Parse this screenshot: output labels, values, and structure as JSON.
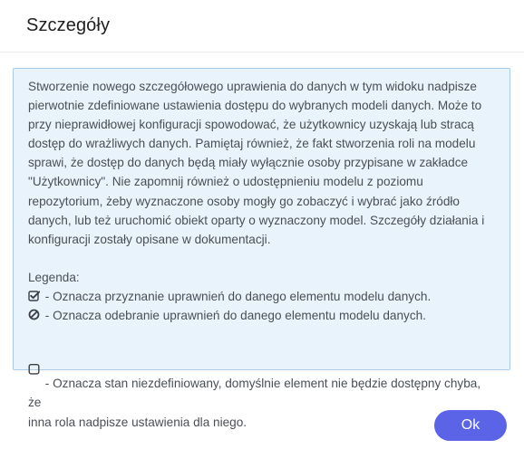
{
  "dialog": {
    "title": "Szczegóły",
    "description": "Stworzenie nowego szczegółowego uprawienia do danych w tym widoku nadpisze\npierwotnie zdefiniowane ustawienia dostępu do wybranych modeli danych. Może to\nprzy nieprawidłowej konfiguracji spowodować, że użytkownicy uzyskają lub stracą\ndostęp do wrażliwych danych. Pamiętaj również, że fakt stworzenia roli na modelu\nsprawi, że dostęp do danych będą miały wyłącznie osoby przypisane w zakładce\n\"Użytkownicy\". Nie zapomnij również o udostępnieniu modelu z poziomu\nrepozytorium, żeby wyznaczone osoby mogły go zobaczyć i wybrać jako źródło\ndanych, lub też uruchomić obiekt oparty o wyznaczony model. Szczegóły działania i\nkonfiguracji zostały opisane w dokumentacji.",
    "legend": {
      "title": "Legenda:",
      "items": [
        {
          "icon": "checked-box-icon",
          "text": " - Oznacza przyznanie uprawnień do danego elementu modelu danych."
        },
        {
          "icon": "ban-icon",
          "text": " - Oznacza odebranie uprawnień do danego elementu modelu danych."
        },
        {
          "icon": "empty-box-icon",
          "text": " - Oznacza stan niezdefiniowany, domyślnie element nie będzie dostępny chyba, że\ninna rola nadpisze ustawienia dla niego."
        }
      ]
    },
    "ok_label": "Ok"
  },
  "colors": {
    "accent": "#5b63e6",
    "info_background": "#e9f3fb",
    "info_border": "#a9cde8",
    "text": "#4a4f56"
  }
}
